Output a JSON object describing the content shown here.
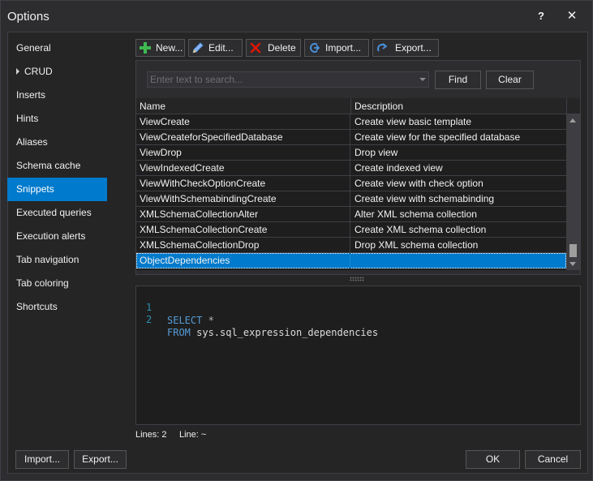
{
  "window": {
    "title": "Options",
    "help_label": "?",
    "close_label": "✕"
  },
  "nav": {
    "items": [
      {
        "label": "General"
      },
      {
        "label": "CRUD",
        "expandable": true
      },
      {
        "label": "Inserts"
      },
      {
        "label": "Hints"
      },
      {
        "label": "Aliases"
      },
      {
        "label": "Schema cache"
      },
      {
        "label": "Snippets",
        "selected": true
      },
      {
        "label": "Executed queries"
      },
      {
        "label": "Execution alerts"
      },
      {
        "label": "Tab navigation"
      },
      {
        "label": "Tab coloring"
      },
      {
        "label": "Shortcuts"
      }
    ]
  },
  "toolbar": {
    "new_label": "New...",
    "edit_label": "Edit...",
    "delete_label": "Delete",
    "import_label": "Import...",
    "export_label": "Export..."
  },
  "search": {
    "placeholder": "Enter text to search...",
    "find_label": "Find",
    "clear_label": "Clear"
  },
  "grid": {
    "columns": [
      "Name",
      "Description"
    ],
    "rows": [
      {
        "name": "ViewCreate",
        "description": "Create view basic template"
      },
      {
        "name": "ViewCreateforSpecifiedDatabase",
        "description": "Create view for the specified database"
      },
      {
        "name": "ViewDrop",
        "description": "Drop view"
      },
      {
        "name": "ViewIndexedCreate",
        "description": "Create indexed view"
      },
      {
        "name": "ViewWithCheckOptionCreate",
        "description": "Create view with check option"
      },
      {
        "name": "ViewWithSchemabindingCreate",
        "description": "Create view with schemabinding"
      },
      {
        "name": "XMLSchemaCollectionAlter",
        "description": "Alter XML schema collection"
      },
      {
        "name": "XMLSchemaCollectionCreate",
        "description": "Create XML schema collection"
      },
      {
        "name": "XMLSchemaCollectionDrop",
        "description": "Drop XML schema collection"
      },
      {
        "name": "ObjectDependencies",
        "description": "",
        "selected": true
      }
    ]
  },
  "editor": {
    "lines": [
      {
        "number": "1",
        "keyword": "SELECT",
        "rest_op": " *",
        "rest_text": ""
      },
      {
        "number": "2",
        "keyword": "FROM",
        "rest_op": "",
        "rest_text": " sys.sql_expression_dependencies"
      }
    ]
  },
  "status": {
    "lines_label": "Lines: 2",
    "line_label": "Line: ~"
  },
  "footer": {
    "import_label": "Import...",
    "export_label": "Export...",
    "ok_label": "OK",
    "cancel_label": "Cancel"
  },
  "colors": {
    "accent": "#007acc",
    "background": "#2d2d30",
    "panel": "#252526",
    "editor": "#1e1e1e",
    "add_icon": "#3fb950",
    "delete_icon": "#e51400"
  },
  "icons": {
    "new": "plus-icon",
    "edit": "pencil-icon",
    "delete": "x-icon",
    "import": "import-arrow-icon",
    "export": "export-arrow-icon"
  }
}
